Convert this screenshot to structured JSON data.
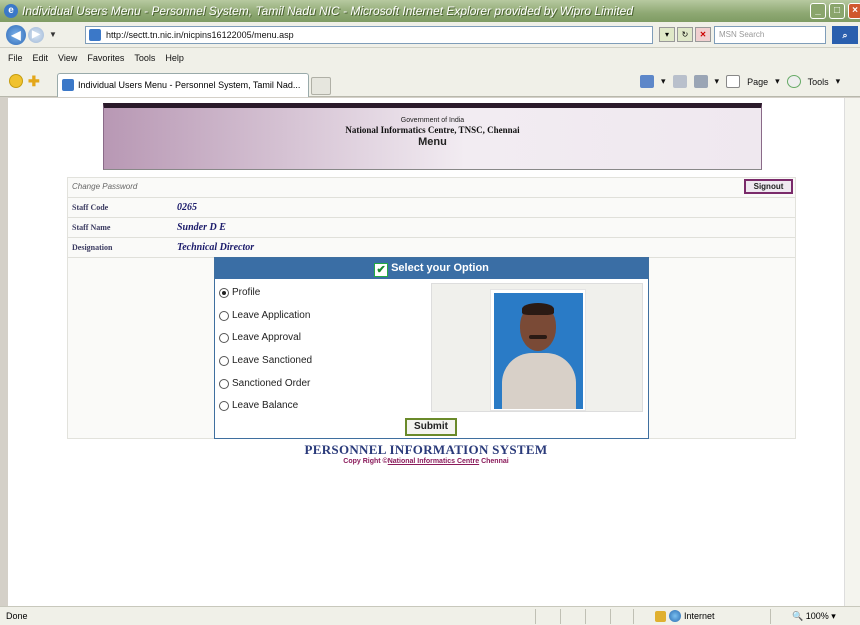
{
  "window": {
    "title": "Individual Users Menu - Personnel System, Tamil Nadu NIC - Microsoft Internet Explorer provided by Wipro Limited"
  },
  "addressbar": {
    "url": "http://sectt.tn.nic.in/nicpins16122005/menu.asp",
    "search_placeholder": "MSN Search"
  },
  "menubar": {
    "items": [
      "File",
      "Edit",
      "View",
      "Favorites",
      "Tools",
      "Help"
    ]
  },
  "tabbar": {
    "tab_label": "Individual Users Menu - Personnel System, Tamil Nad...",
    "page_label": "Page",
    "tools_label": "Tools"
  },
  "banner": {
    "line1": "Government of India",
    "line2": "National Informatics Centre, TNSC, Chennai",
    "line3": "Menu"
  },
  "panel": {
    "change_password": "Change Password",
    "signout": "Signout",
    "fields": [
      {
        "label": "Staff Code",
        "value": "0265"
      },
      {
        "label": "Staff Name",
        "value": "Sunder D E"
      },
      {
        "label": "Designation",
        "value": "Technical Director"
      }
    ]
  },
  "options": {
    "header": "Select your Option",
    "selected_index": 0,
    "items": [
      "Profile",
      "Leave Application",
      "Leave Approval",
      "Leave Sanctioned",
      "Sanctioned Order",
      "Leave Balance"
    ],
    "submit": "Submit"
  },
  "footer": {
    "title": "PERSONNEL INFORMATION SYSTEM",
    "copyright_prefix": "Copy Right ©",
    "copyright_link": "National Informatics Centre",
    "copyright_suffix": " Chennai"
  },
  "statusbar": {
    "status": "Done",
    "zone": "Internet",
    "zoom": "100%"
  }
}
